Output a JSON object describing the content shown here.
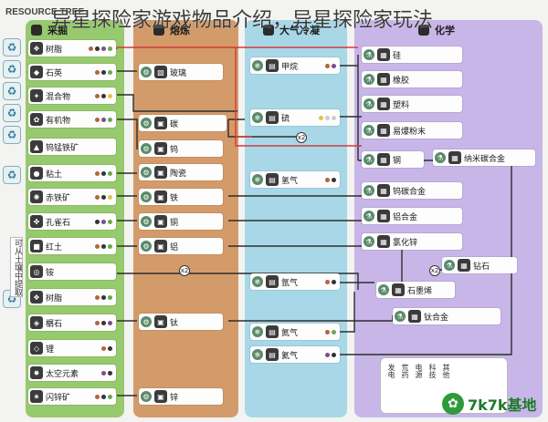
{
  "overlay_title": "异星探险家游戏物品介绍，异星探险家玩法",
  "tree_label": "RESOURCE TREE",
  "columns": {
    "mine": "采掘",
    "smelt": "熔炼",
    "atmo": "大气冷凝",
    "chem": "化学"
  },
  "side_label": "可从土壤中提取",
  "mine_items": [
    "树脂",
    "石英",
    "混合物",
    "有机物",
    "钨锰铁矿",
    "粘土",
    "赤铁矿",
    "孔雀石",
    "红土",
    "铵",
    "树脂",
    "榍石",
    "锂",
    "太空元素",
    "闪锌矿"
  ],
  "smelt_items": [
    "玻璃",
    "碳",
    "钨",
    "陶瓷",
    "铁",
    "铜",
    "铝",
    "钛",
    "锌"
  ],
  "atmo_items": [
    "甲烷",
    "硫",
    "氢气",
    "氩气",
    "氮气",
    "氦气"
  ],
  "chem_items": [
    "硅",
    "橡胶",
    "塑料",
    "易爆粉末",
    "钢",
    "纳米碳合金",
    "钨碳合金",
    "铝合金",
    "氯化锌",
    "钻石",
    "石墨烯",
    "钛合金"
  ],
  "x2_label": "x2",
  "legend_items": [
    "发电",
    "荒药",
    "电源",
    "科技",
    "其他"
  ],
  "logo": "7k7k基地",
  "colors": {
    "mine_bg": "#97c96e",
    "smelt_bg": "#d49b6a",
    "atmo_bg": "#a8d8e8",
    "chem_bg": "#c8b6e8",
    "line_dark": "#2d2d2d",
    "line_red": "#d43a3a"
  }
}
